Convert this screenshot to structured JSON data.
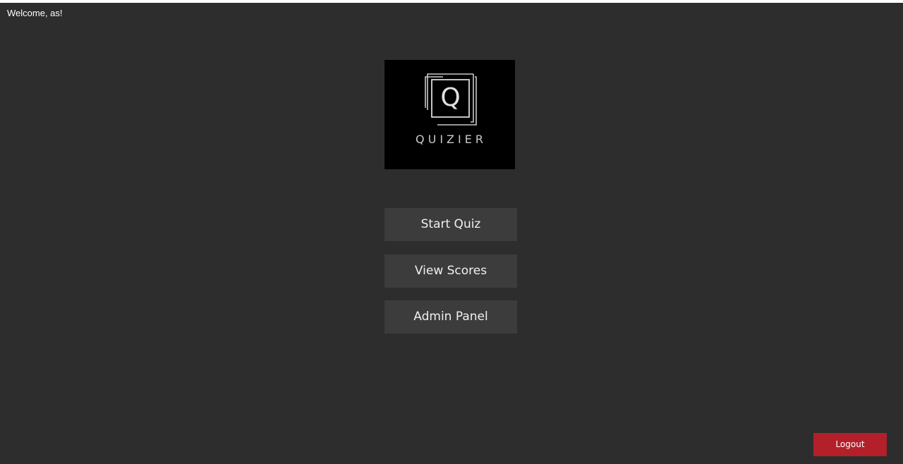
{
  "header": {
    "welcome_text": "Welcome, as!"
  },
  "logo": {
    "letter": "Q",
    "brand_name": "QUIZIER"
  },
  "menu": {
    "start_quiz_label": "Start Quiz",
    "view_scores_label": "View Scores",
    "admin_panel_label": "Admin Panel"
  },
  "footer": {
    "logout_label": "Logout"
  },
  "colors": {
    "background": "#2d2d2d",
    "button": "#3c3c3c",
    "logout": "#b3202a",
    "logo_bg": "#000000"
  }
}
